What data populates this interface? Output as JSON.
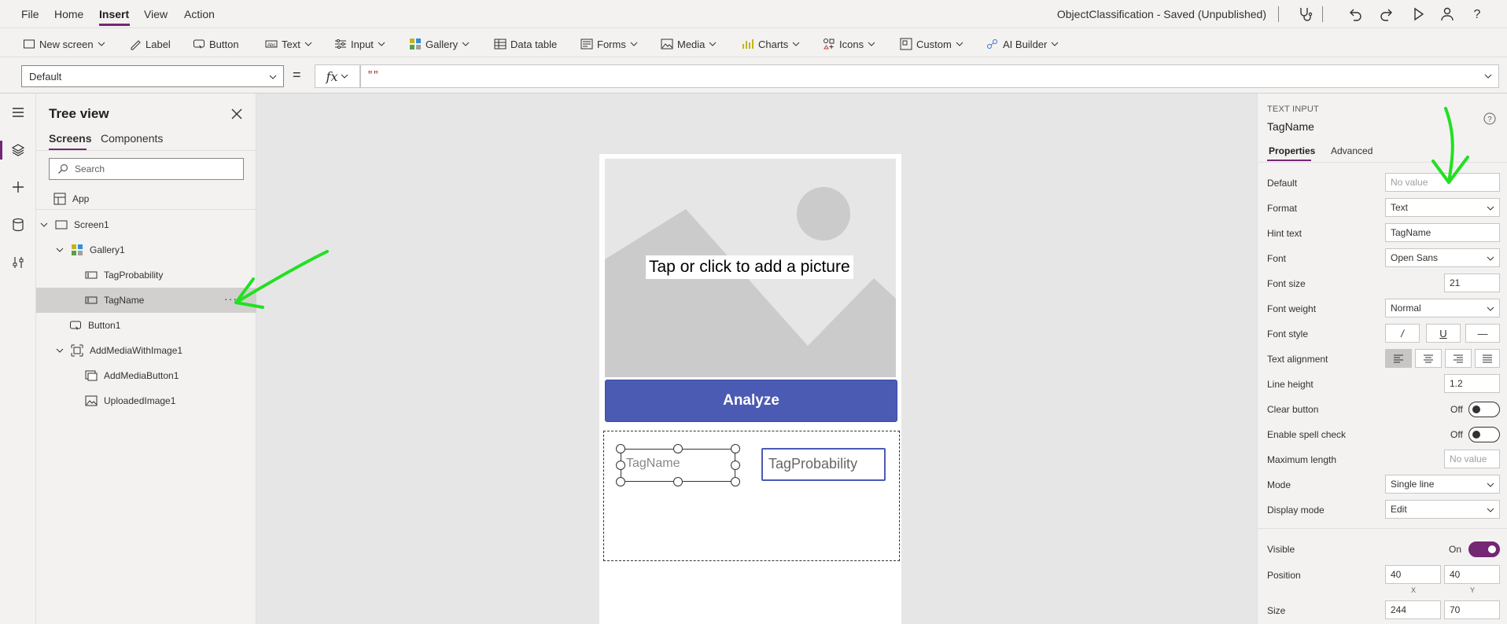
{
  "menubar": {
    "items": [
      "File",
      "Home",
      "Insert",
      "View",
      "Action"
    ],
    "active": "Insert",
    "app_title": "ObjectClassification - Saved (Unpublished)"
  },
  "toolbar": {
    "items": [
      "New screen",
      "Label",
      "Button",
      "Text",
      "Input",
      "Gallery",
      "Data table",
      "Forms",
      "Media",
      "Charts",
      "Icons",
      "Custom",
      "AI Builder"
    ]
  },
  "formula": {
    "property": "Default",
    "equals": "=",
    "fx": "fx",
    "value": "\"\""
  },
  "tree": {
    "title": "Tree view",
    "tabs": [
      "Screens",
      "Components"
    ],
    "search_placeholder": "Search",
    "app_node": "App",
    "nodes": [
      "Screen1",
      "Gallery1",
      "TagProbability",
      "TagName",
      "Button1",
      "AddMediaWithImage1",
      "AddMediaButton1",
      "UploadedImage1"
    ],
    "selected": "TagName",
    "more": "···"
  },
  "canvas": {
    "image_caption": "Tap or click to add a picture",
    "analyze_label": "Analyze",
    "tagname_hint": "TagName",
    "tagprob_hint": "TagProbability"
  },
  "properties": {
    "kind": "TEXT INPUT",
    "name": "TagName",
    "tabs": [
      "Properties",
      "Advanced"
    ],
    "rows": {
      "default": {
        "label": "Default",
        "placeholder": "No value"
      },
      "format": {
        "label": "Format",
        "value": "Text"
      },
      "hint": {
        "label": "Hint text",
        "value": "TagName"
      },
      "font": {
        "label": "Font",
        "value": "Open Sans"
      },
      "font_size": {
        "label": "Font size",
        "value": "21"
      },
      "font_weight": {
        "label": "Font weight",
        "value": "Normal"
      },
      "font_style": {
        "label": "Font style",
        "buttons": [
          "/",
          "U",
          "—"
        ]
      },
      "text_alignment": {
        "label": "Text alignment"
      },
      "line_height": {
        "label": "Line height",
        "value": "1.2"
      },
      "clear_button": {
        "label": "Clear button",
        "state": "Off"
      },
      "spell_check": {
        "label": "Enable spell check",
        "state": "Off"
      },
      "max_length": {
        "label": "Maximum length",
        "placeholder": "No value"
      },
      "mode": {
        "label": "Mode",
        "value": "Single line"
      },
      "display_mode": {
        "label": "Display mode",
        "value": "Edit"
      },
      "visible": {
        "label": "Visible",
        "state": "On"
      },
      "position": {
        "label": "Position",
        "x": "40",
        "y": "40",
        "x_label": "X",
        "y_label": "Y"
      },
      "size": {
        "label": "Size",
        "w": "244",
        "h": "70"
      }
    }
  },
  "colors": {
    "accent": "#742774",
    "analyze": "#4b5ab3",
    "annotation_arrow": "#22e022"
  }
}
